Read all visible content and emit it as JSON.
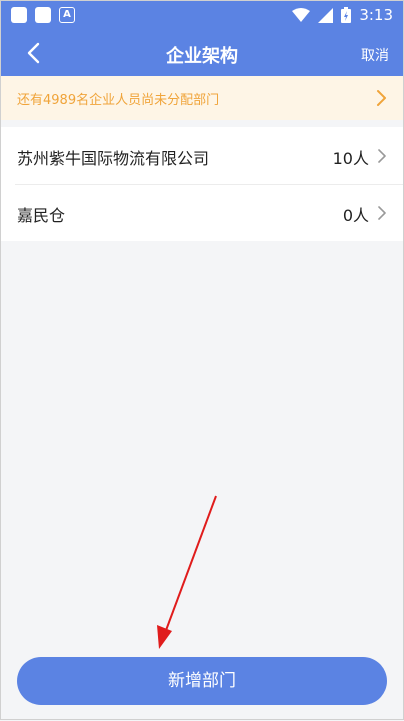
{
  "status_bar": {
    "time": "3:13",
    "a_badge": "A"
  },
  "nav": {
    "title": "企业架构",
    "cancel_label": "取消"
  },
  "notice": {
    "text": "还有4989名企业人员尚未分配部门"
  },
  "departments": [
    {
      "name": "苏州紫牛国际物流有限公司",
      "count": "10人"
    },
    {
      "name": "嘉民仓",
      "count": "0人"
    }
  ],
  "footer": {
    "add_button_label": "新增部门"
  },
  "colors": {
    "primary": "#5b83e3",
    "notice_bg": "#fef5e6",
    "notice_text": "#f0a43a",
    "annotation_arrow": "#e01c1c"
  }
}
